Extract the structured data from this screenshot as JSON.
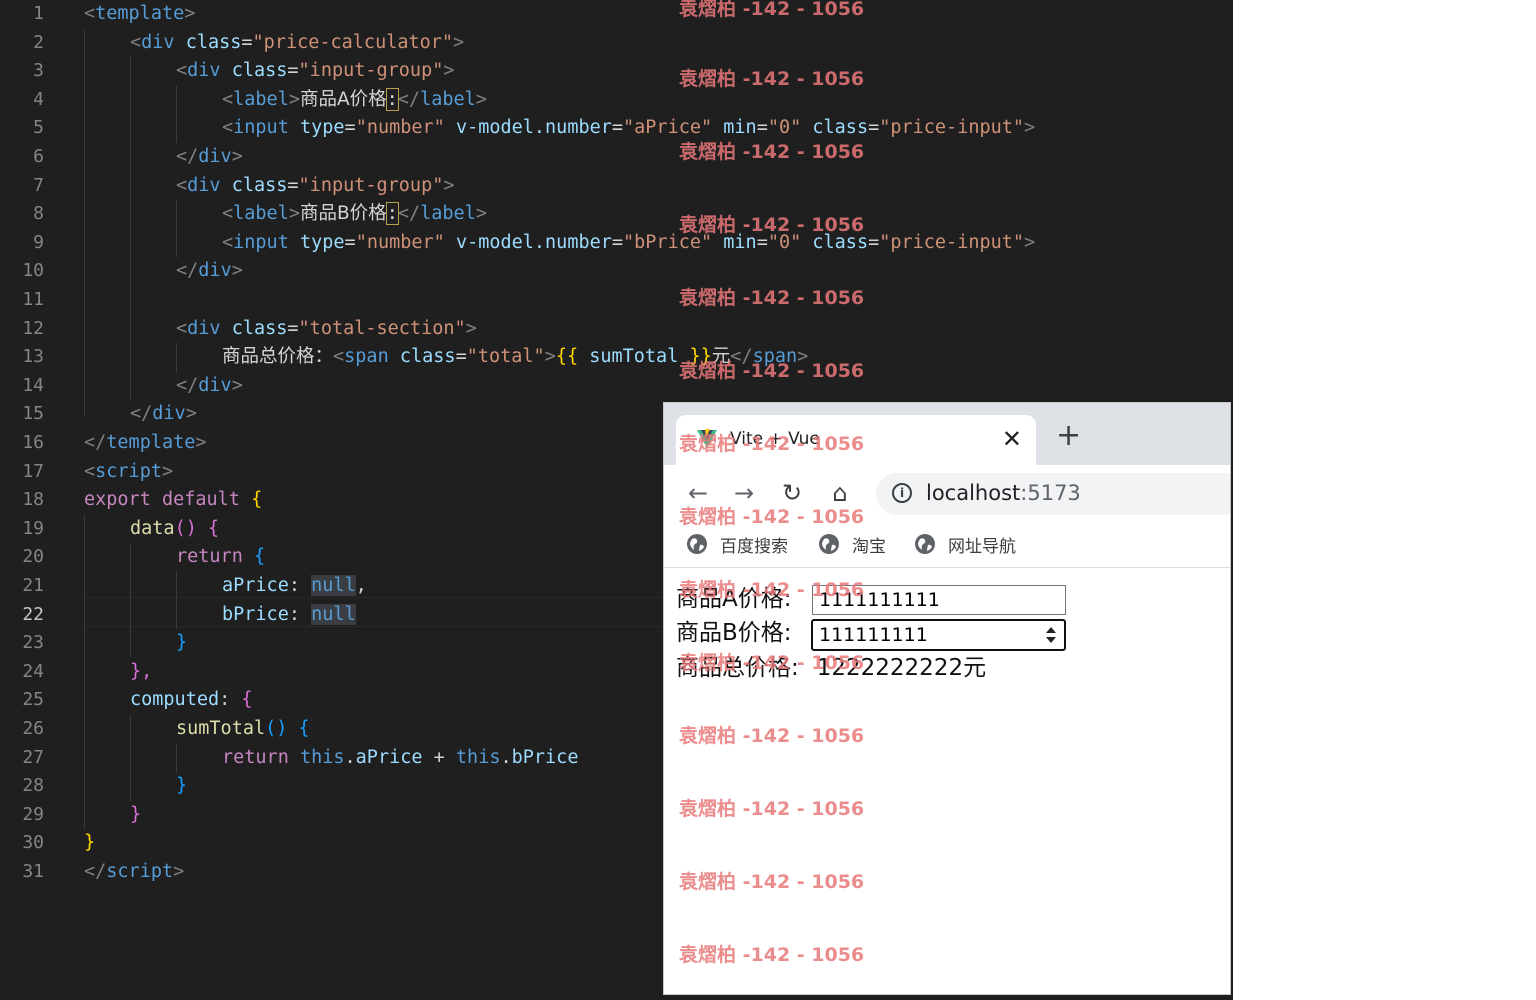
{
  "editor": {
    "line_numbers": [
      "1",
      "2",
      "3",
      "4",
      "5",
      "6",
      "7",
      "8",
      "9",
      "10",
      "11",
      "12",
      "13",
      "14",
      "15",
      "16",
      "17",
      "18",
      "19",
      "20",
      "21",
      "22",
      "23",
      "24",
      "25",
      "26",
      "27",
      "28",
      "29",
      "30",
      "31"
    ],
    "active_line": "22",
    "code": {
      "l1": "template",
      "l2_tag": "div",
      "l2_attr": "class",
      "l2_val": "\"price-calculator\"",
      "l3_tag": "div",
      "l3_attr": "class",
      "l3_val": "\"input-group\"",
      "l4_tag": "label",
      "l4_text": "商品A价格",
      "l4_colon": ":",
      "l4_close": "label",
      "l5_tag": "input",
      "l5_a1": "type",
      "l5_v1": "\"number\"",
      "l5_a2": "v-model.number",
      "l5_v2": "\"aPrice\"",
      "l5_a3": "min",
      "l5_v3": "\"0\"",
      "l5_a4": "class",
      "l5_v4": "\"price-input\"",
      "l6": "div",
      "l7_tag": "div",
      "l7_attr": "class",
      "l7_val": "\"input-group\"",
      "l8_tag": "label",
      "l8_text": "商品B价格",
      "l8_colon": ":",
      "l8_close": "label",
      "l9_tag": "input",
      "l9_a1": "type",
      "l9_v1": "\"number\"",
      "l9_a2": "v-model.number",
      "l9_v2": "\"bPrice\"",
      "l9_a3": "min",
      "l9_v3": "\"0\"",
      "l9_a4": "class",
      "l9_v4": "\"price-input\"",
      "l10": "div",
      "l12_tag": "div",
      "l12_attr": "class",
      "l12_val": "\"total-section\"",
      "l13_text": "商品总价格：",
      "l13_tag": "span",
      "l13_attr": "class",
      "l13_val": "\"total\"",
      "l13_open": "{{",
      "l13_expr": "sumTotal",
      "l13_close": "}}",
      "l13_unit": "元",
      "l13_end": "span",
      "l14": "div",
      "l15": "div",
      "l16": "template",
      "l17": "script",
      "l18_kw1": "export",
      "l18_kw2": "default",
      "l18_br": "{",
      "l19_fn": "data",
      "l19_par": "()",
      "l19_br": "{",
      "l20_kw": "return",
      "l20_br": "{",
      "l21_key": "aPrice",
      "l21_val": "null",
      "l22_key": "bPrice",
      "l22_val": "null",
      "l23_br": "}",
      "l24_br": "},",
      "l25_key": "computed",
      "l25_br": "{",
      "l26_fn": "sumTotal",
      "l26_par": "()",
      "l26_br": "{",
      "l27_kw": "return",
      "l27_this1": "this",
      "l27_p1": "aPrice",
      "l27_op": "+",
      "l27_this2": "this",
      "l27_p2": "bPrice",
      "l28_br": "}",
      "l29_br": "}",
      "l30_br": "}",
      "l31": "script"
    }
  },
  "browser": {
    "tab_title": "Vite + Vue",
    "tab_close": "✕",
    "new_tab": "+",
    "url_host": "localhost",
    "url_port": ":5173",
    "nav": {
      "back": "←",
      "forward": "→",
      "reload": "↻",
      "home": "⌂"
    },
    "bookmarks": [
      "百度搜索",
      "淘宝",
      "网址导航"
    ],
    "page": {
      "label_a": "商品A价格:",
      "value_a": "1111111111",
      "label_b": "商品B价格:",
      "value_b": "111111111",
      "total_label": "商品总价格:",
      "total_value": "1222222222元"
    }
  },
  "watermark": "袁熠柏 -142 - 1056",
  "colors": {
    "editor_bg": "#1f1f1f",
    "tag": "#569cd6",
    "string": "#ce9178",
    "attribute": "#9cdcfe",
    "keyword": "#c586c0",
    "function": "#dcdcaa"
  }
}
